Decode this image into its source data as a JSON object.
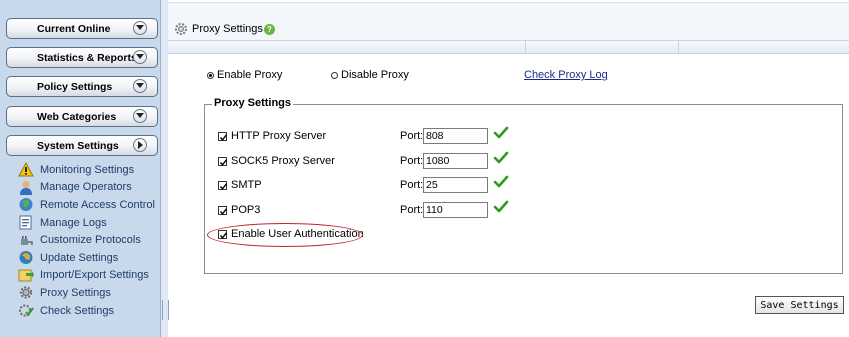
{
  "sidebar": {
    "menu": [
      {
        "label": "Current Online",
        "state": "collapsed"
      },
      {
        "label": "Statistics & Reports",
        "state": "collapsed"
      },
      {
        "label": "Policy Settings",
        "state": "collapsed"
      },
      {
        "label": "Web Categories",
        "state": "collapsed"
      },
      {
        "label": "System Settings",
        "state": "expanded"
      }
    ],
    "system_items": [
      {
        "label": "Monitoring Settings",
        "icon": "warning-icon"
      },
      {
        "label": "Manage Operators",
        "icon": "user-icon"
      },
      {
        "label": "Remote Access Control",
        "icon": "globe-icon"
      },
      {
        "label": "Manage Logs",
        "icon": "log-icon"
      },
      {
        "label": "Customize Protocols",
        "icon": "plug-icon"
      },
      {
        "label": "Update Settings",
        "icon": "update-globe-icon"
      },
      {
        "label": "Import/Export Settings",
        "icon": "import-export-icon"
      },
      {
        "label": "Proxy Settings",
        "icon": "gear-icon"
      },
      {
        "label": "Check Settings",
        "icon": "check-gear-icon"
      }
    ]
  },
  "header": {
    "title": "Proxy Settings",
    "help": "?"
  },
  "proxy_mode": {
    "enable_label": "Enable Proxy",
    "disable_label": "Disable Proxy",
    "selected": "Enable Proxy",
    "log_link": "Check Proxy Log"
  },
  "proxy_settings": {
    "legend": "Proxy Settings",
    "port_label": "Port:",
    "servers": [
      {
        "label": "HTTP Proxy Server",
        "checked": true,
        "port": "808"
      },
      {
        "label": "SOCK5 Proxy Server",
        "checked": true,
        "port": "1080"
      },
      {
        "label": "SMTP",
        "checked": true,
        "port": "25"
      },
      {
        "label": "POP3",
        "checked": true,
        "port": "110"
      }
    ],
    "auth": {
      "label": "Enable User Authentication",
      "checked": true
    }
  },
  "actions": {
    "save_label": "Save Settings"
  },
  "colors": {
    "sidebar_bg": "#c9d9ec",
    "link": "#1a2d86",
    "ok_check": "#2e9a1e",
    "highlight_oval": "#c0232c"
  }
}
